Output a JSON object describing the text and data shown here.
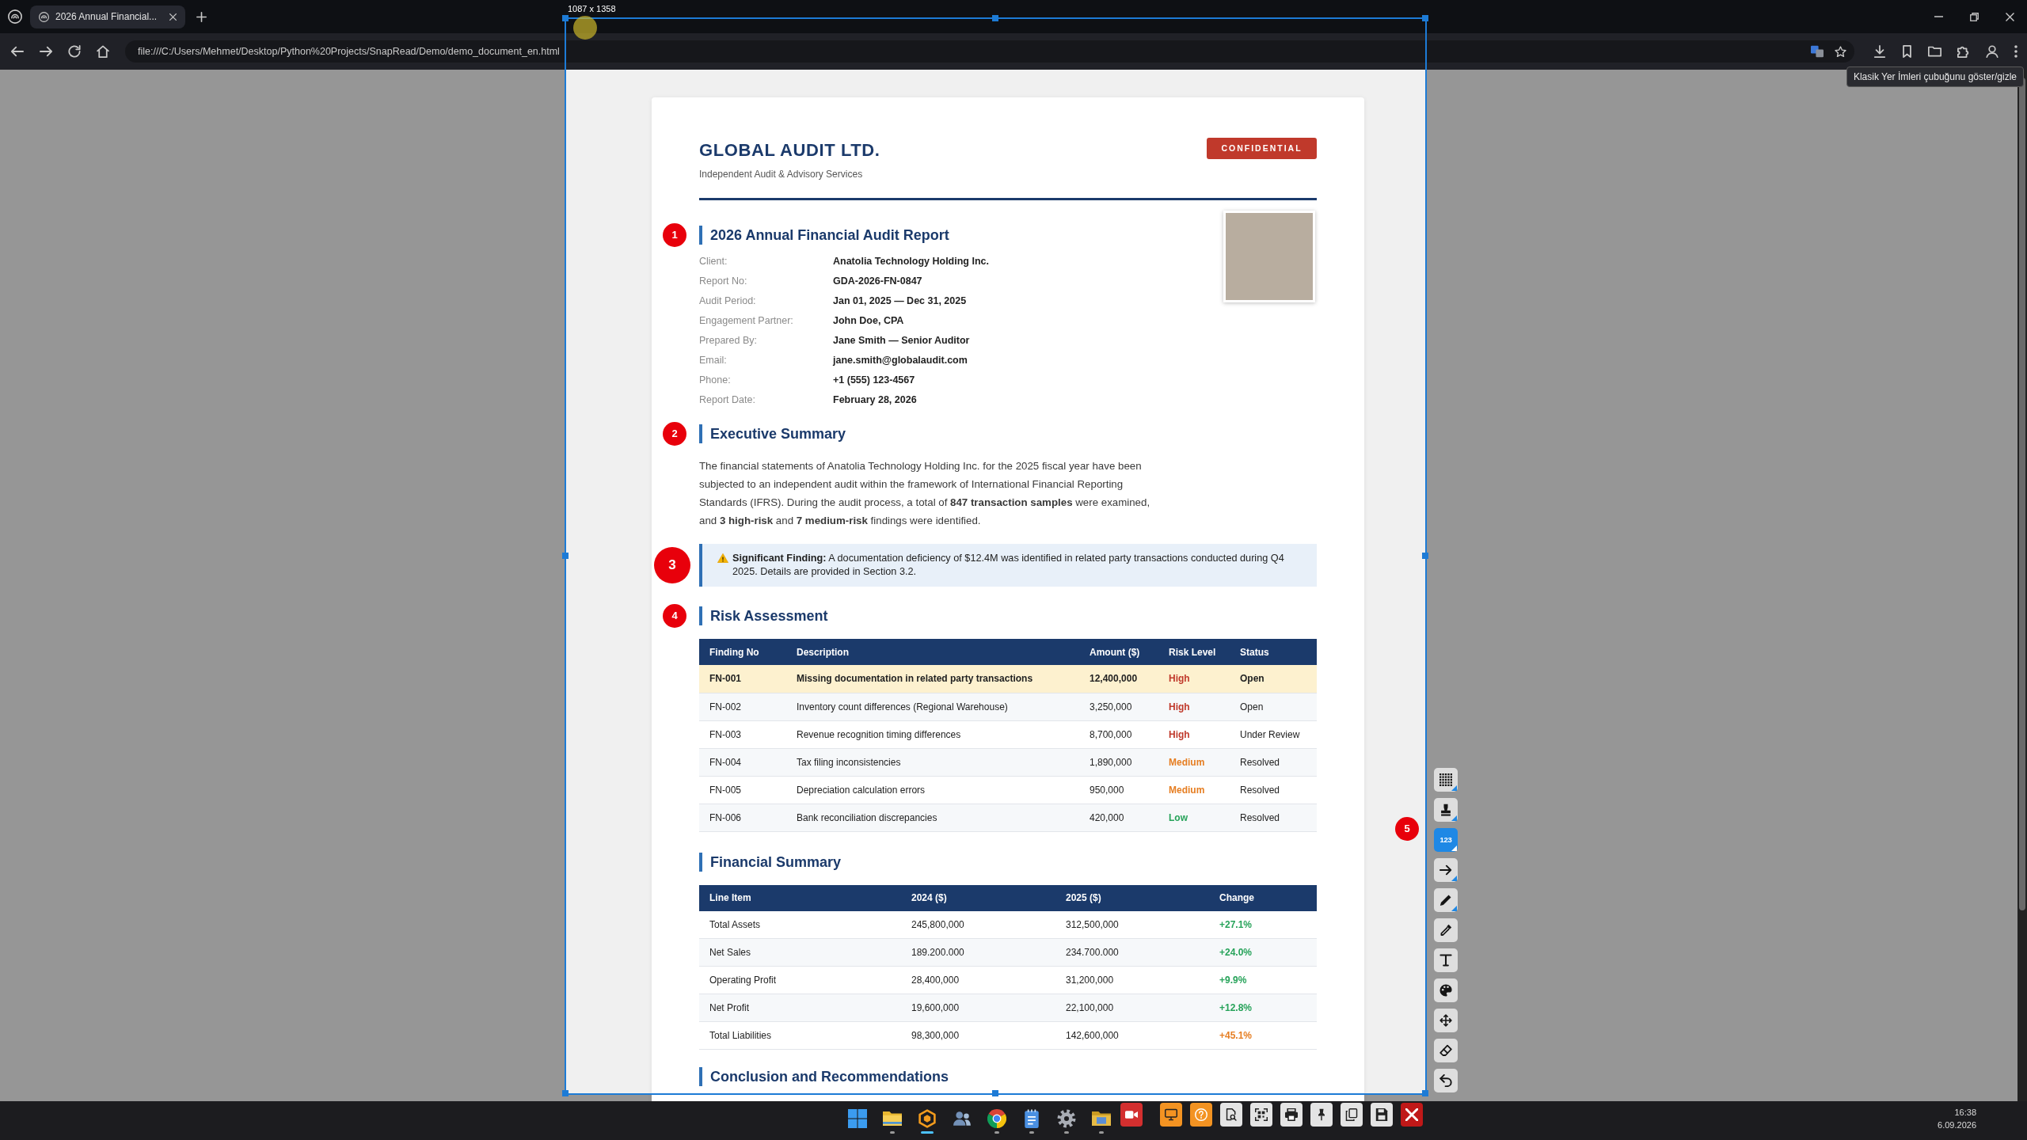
{
  "browser": {
    "tabs": [
      {
        "title": "2026 Annual Financial...",
        "selected": true
      }
    ],
    "address_bar": {
      "url": "file:///C:/Users/Mehmet/Desktop/Python%20Projects/SnapRead/Demo/demo_document_en.html"
    },
    "tooltip": "Klasik Yer İmleri çubuğunu göster/gizle"
  },
  "capture": {
    "size_label": "1087 x 1358"
  },
  "document": {
    "company": "GLOBAL AUDIT LTD.",
    "tagline": "Independent Audit & Advisory Services",
    "badge": "CONFIDENTIAL",
    "report": {
      "marker": "1",
      "title": "2026 Annual Financial Audit Report",
      "details": [
        {
          "label": "Client:",
          "value": "Anatolia Technology Holding Inc."
        },
        {
          "label": "Report No:",
          "value": "GDA-2026-FN-0847"
        },
        {
          "label": "Audit Period:",
          "value": "Jan 01, 2025 — Dec 31, 2025"
        },
        {
          "label": "Engagement Partner:",
          "value": "John Doe, CPA"
        },
        {
          "label": "Prepared By:",
          "value": "Jane Smith — Senior Auditor"
        },
        {
          "label": "Email:",
          "value": "jane.smith@globalaudit.com"
        },
        {
          "label": "Phone:",
          "value": "+1 (555) 123-4567"
        },
        {
          "label": "Report Date:",
          "value": "February 28, 2026"
        }
      ]
    },
    "summary": {
      "marker": "2",
      "title": "Executive Summary",
      "text": "The financial statements of Anatolia Technology Holding Inc. for the 2025 fiscal year have been subjected to an independent audit within the framework of International Financial Reporting Standards (IFRS). During the audit process, a total of **847 transaction samples** were examined, and **3 high-risk** and **7 medium-risk** findings were identified.",
      "callout": {
        "marker": "3",
        "text": "**Significant Finding:** A documentation deficiency of $12.4M was identified in related party transactions conducted during Q4 2025. Details are provided in Section 3.2."
      }
    },
    "risk": {
      "marker": "4",
      "title": "Risk Assessment",
      "columns": [
        "Finding No",
        "Description",
        "Amount ($)",
        "Risk Level",
        "Status"
      ],
      "rows": [
        {
          "finding_no": "FN-001",
          "description": "Missing documentation in related party transactions",
          "amount": "12,400,000",
          "risk_level": "High",
          "color": "#c0392b",
          "status": "Open",
          "highlighted": true
        },
        {
          "finding_no": "FN-002",
          "description": "Inventory count differences (Regional Warehouse)",
          "amount": "3,250,000",
          "risk_level": "High",
          "color": "#c0392b",
          "status": "Open",
          "highlighted": false
        },
        {
          "finding_no": "FN-003",
          "description": "Revenue recognition timing differences",
          "amount": "8,700,000",
          "risk_level": "High",
          "color": "#c0392b",
          "status": "Under Review",
          "highlighted": false
        },
        {
          "finding_no": "FN-004",
          "description": "Tax filing inconsistencies",
          "amount": "1,890,000",
          "risk_level": "Medium",
          "color": "#e67e22",
          "status": "Resolved",
          "highlighted": false
        },
        {
          "finding_no": "FN-005",
          "description": "Depreciation calculation errors",
          "amount": "950,000",
          "risk_level": "Medium",
          "color": "#e67e22",
          "status": "Resolved",
          "highlighted": false
        },
        {
          "finding_no": "FN-006",
          "description": "Bank reconciliation discrepancies",
          "amount": "420,000",
          "risk_level": "Low",
          "color": "#27a35a",
          "status": "Resolved",
          "highlighted": false
        }
      ]
    },
    "financial": {
      "title": "Financial Summary",
      "columns": [
        "Line Item",
        "2024 ($)",
        "2025 ($)",
        "Change"
      ],
      "rows": [
        {
          "line_item": "Total Assets",
          "value_2024": "245,800,000",
          "value_2025": "312,500,000",
          "change": "+27.1%",
          "color": "#27a35a"
        },
        {
          "line_item": "Net Sales",
          "value_2024": "189.200.000",
          "value_2025": "234.700.000",
          "change": "+24.0%",
          "color": "#27a35a"
        },
        {
          "line_item": "Operating Profit",
          "value_2024": "28,400,000",
          "value_2025": "31,200,000",
          "change": "+9.9%",
          "color": "#27a35a"
        },
        {
          "line_item": "Net Profit",
          "value_2024": "19,600,000",
          "value_2025": "22,100,000",
          "change": "+12.8%",
          "color": "#27a35a"
        },
        {
          "line_item": "Total Liabilities",
          "value_2024": "98,300,000",
          "value_2025": "142,600,000",
          "change": "+45.1%",
          "color": "#e67e22"
        }
      ]
    },
    "next_section": {
      "title": "Conclusion and Recommendations"
    }
  },
  "annotation_tools": {
    "marker": "5",
    "tools": [
      {
        "kind": "mosaic",
        "has_options": true,
        "selected": false
      },
      {
        "kind": "stamp",
        "has_options": true,
        "selected": false
      },
      {
        "kind": "numbering",
        "label": "123",
        "has_options": true,
        "selected": true
      },
      {
        "kind": "arrow",
        "has_options": true,
        "selected": false
      },
      {
        "kind": "pen",
        "has_options": true,
        "selected": false
      },
      {
        "kind": "eyedropper",
        "has_options": false,
        "selected": false
      },
      {
        "kind": "text",
        "has_options": false,
        "selected": false
      },
      {
        "kind": "palette",
        "has_options": false,
        "selected": false
      },
      {
        "kind": "move",
        "has_options": false,
        "selected": false
      },
      {
        "kind": "eraser",
        "has_options": false,
        "selected": false
      },
      {
        "kind": "undo",
        "has_options": false,
        "selected": false
      }
    ]
  },
  "taskbar": {
    "apps": [
      {
        "kind": "start",
        "running": false,
        "active": false
      },
      {
        "kind": "files",
        "running": true,
        "active": false
      },
      {
        "kind": "hexagon",
        "running": true,
        "active": true
      },
      {
        "kind": "users",
        "running": false,
        "active": false
      },
      {
        "kind": "browser",
        "running": true,
        "active": false
      },
      {
        "kind": "notepad",
        "running": true,
        "active": false
      },
      {
        "kind": "settings",
        "running": true,
        "active": false
      },
      {
        "kind": "folder",
        "running": true,
        "active": false
      }
    ],
    "capture_toolbar": [
      {
        "kind": "record"
      },
      {
        "kind": "screen"
      },
      {
        "kind": "help"
      },
      {
        "kind": "ocr"
      },
      {
        "kind": "scan"
      },
      {
        "kind": "print"
      },
      {
        "kind": "pin"
      },
      {
        "kind": "copy"
      },
      {
        "kind": "save"
      },
      {
        "kind": "close"
      }
    ],
    "clock": {
      "time": "16:38",
      "date": "6.09.2026"
    }
  }
}
